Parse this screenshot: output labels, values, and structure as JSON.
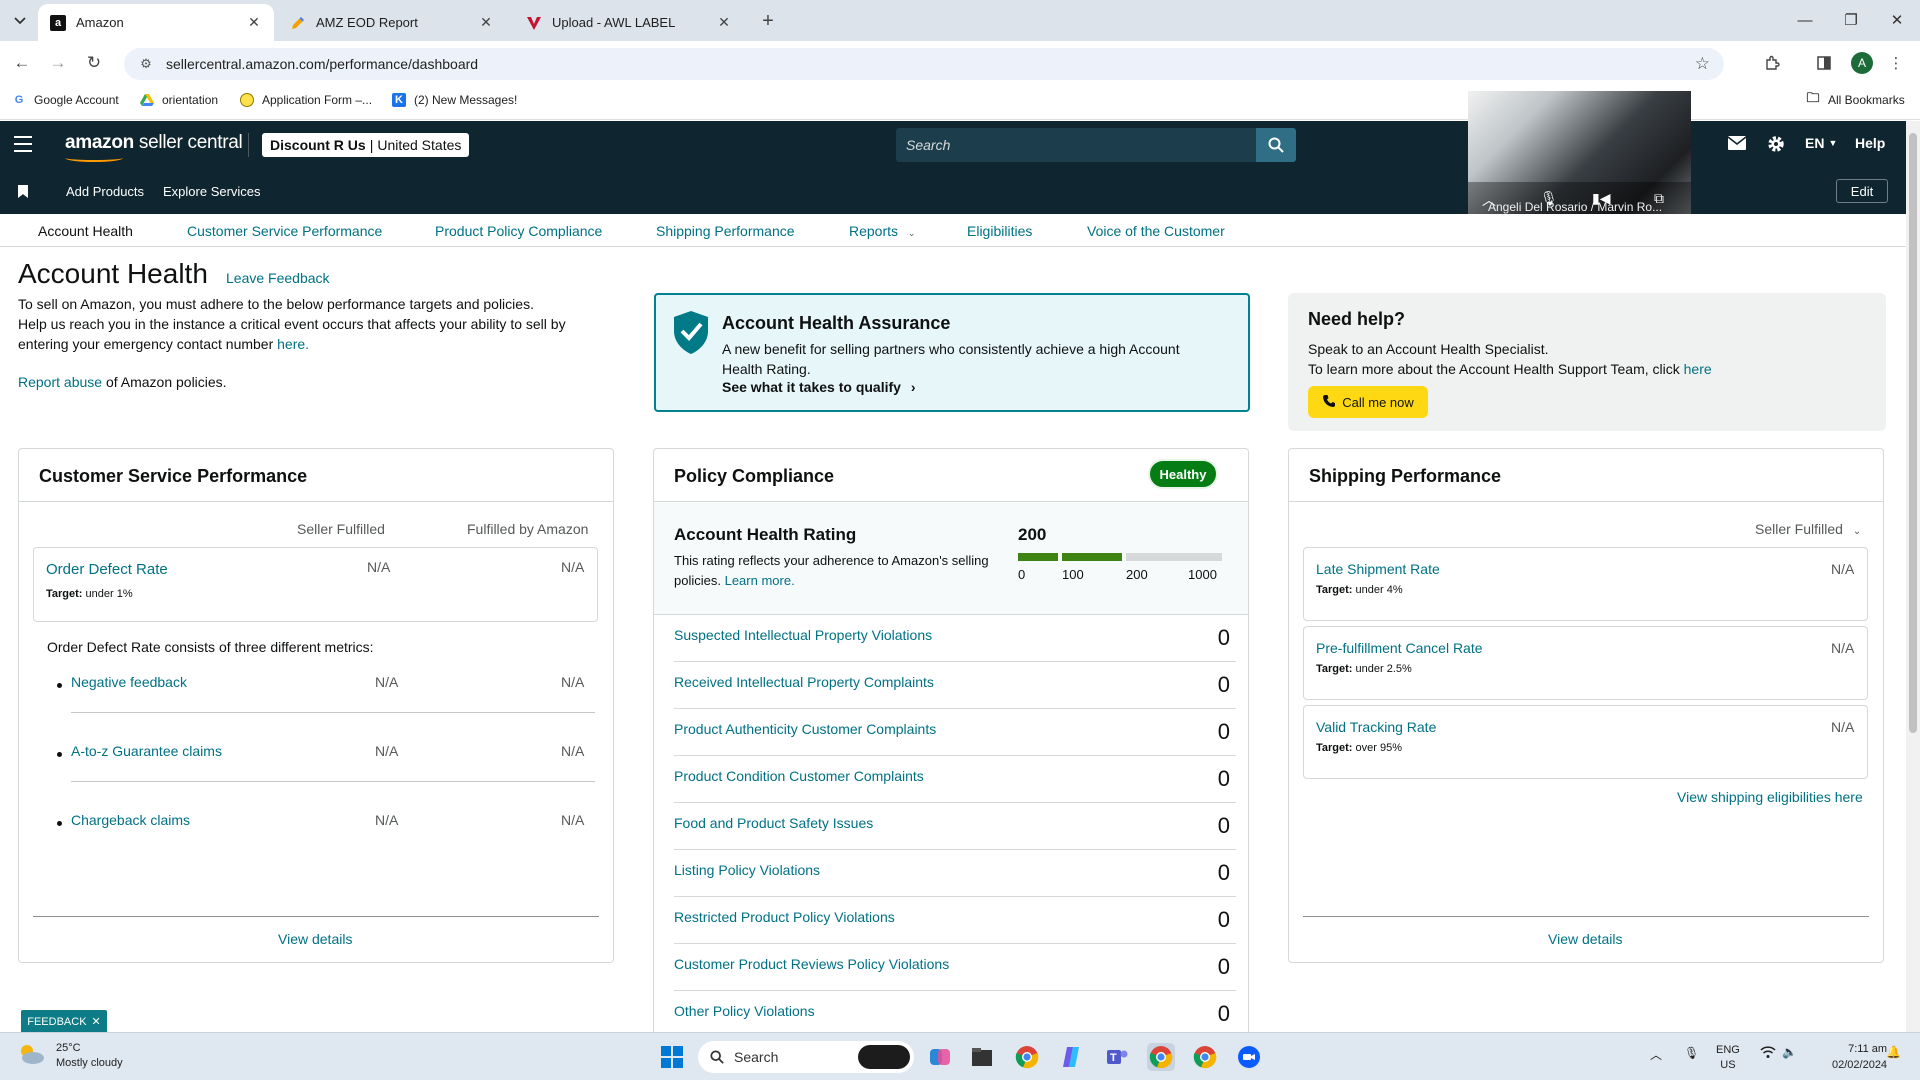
{
  "browser": {
    "tabs": [
      {
        "title": "Amazon",
        "favicon": "a"
      },
      {
        "title": "AMZ EOD Report",
        "favicon": "pen-icon"
      },
      {
        "title": "Upload - AWL LABEL",
        "favicon": "v-icon"
      }
    ],
    "url": "sellercentral.amazon.com/performance/dashboard",
    "profile_initial": "A",
    "bookmarks": [
      "Google Account",
      "orientation",
      "Application Form –...",
      "(2) New Messages!"
    ],
    "all_bookmarks": "All Bookmarks"
  },
  "header": {
    "logo_bold": "amazon",
    "logo_rest": " seller central",
    "store_name": "Discount R Us",
    "store_region": "United States",
    "search_placeholder": "Search",
    "language": "EN",
    "help": "Help",
    "sub_links": [
      "Add Products",
      "Explore Services"
    ],
    "edit": "Edit"
  },
  "video_call": {
    "participants": "Angeli Del Rosario / Marvin Ro..."
  },
  "page_nav": [
    "Account Health",
    "Customer Service Performance",
    "Product Policy Compliance",
    "Shipping Performance",
    "Reports",
    "Eligibilities",
    "Voice of the Customer"
  ],
  "intro": {
    "title": "Account Health",
    "leave_feedback": "Leave Feedback",
    "line1": "To sell on Amazon, you must adhere to the below performance targets and policies.",
    "line2": "Help us reach you in the instance a critical event occurs that affects your ability to sell by entering your emergency contact number",
    "here": "here.",
    "report_abuse": "Report abuse",
    "report_rest": " of Amazon policies."
  },
  "assurance": {
    "title": "Account Health Assurance",
    "desc": "A new benefit for selling partners who consistently achieve a high Account Health Rating.",
    "qualify": "See what it takes to qualify"
  },
  "need_help": {
    "title": "Need help?",
    "line1": "Speak to an Account Health Specialist.",
    "line2": "To learn more about the Account Health Support Team, click",
    "here": "here",
    "call": "Call me now"
  },
  "csp": {
    "title": "Customer Service Performance",
    "col1": "Seller Fulfilled",
    "col2": "Fulfilled by Amazon",
    "odr_label": "Order Defect Rate",
    "odr_target_label": "Target:",
    "odr_target": " under 1%",
    "odr_sf": "N/A",
    "odr_fba": "N/A",
    "consists": "Order Defect Rate consists of three different metrics:",
    "metrics": [
      {
        "name": "Negative feedback",
        "sf": "N/A",
        "fba": "N/A"
      },
      {
        "name": "A-to-z Guarantee claims",
        "sf": "N/A",
        "fba": "N/A"
      },
      {
        "name": "Chargeback claims",
        "sf": "N/A",
        "fba": "N/A"
      }
    ],
    "view_details": "View details"
  },
  "policy": {
    "title": "Policy Compliance",
    "status": "Healthy",
    "ahr_title": "Account Health Rating",
    "ahr_desc": "This rating reflects your adherence to Amazon's selling policies.",
    "learn_more": "Learn more.",
    "score": "200",
    "scale_labels": [
      "0",
      "100",
      "200",
      "1000"
    ],
    "rows": [
      {
        "label": "Suspected Intellectual Property Violations",
        "value": "0"
      },
      {
        "label": "Received Intellectual Property Complaints",
        "value": "0"
      },
      {
        "label": "Product Authenticity Customer Complaints",
        "value": "0"
      },
      {
        "label": "Product Condition Customer Complaints",
        "value": "0"
      },
      {
        "label": "Food and Product Safety Issues",
        "value": "0"
      },
      {
        "label": "Listing Policy Violations",
        "value": "0"
      },
      {
        "label": "Restricted Product Policy Violations",
        "value": "0"
      },
      {
        "label": "Customer Product Reviews Policy Violations",
        "value": "0"
      },
      {
        "label": "Other Policy Violations",
        "value": "0"
      }
    ]
  },
  "shipping": {
    "title": "Shipping Performance",
    "filter": "Seller Fulfilled",
    "metrics": [
      {
        "name": "Late Shipment Rate",
        "target": " under 4%",
        "value": "N/A"
      },
      {
        "name": "Pre-fulfillment Cancel Rate",
        "target": " under 2.5%",
        "value": "N/A"
      },
      {
        "name": "Valid Tracking Rate",
        "target": " over 95%",
        "value": "N/A"
      }
    ],
    "target_label": "Target:",
    "eligibilities": "View shipping eligibilities here",
    "view_details": "View details"
  },
  "feedback_tag": "FEEDBACK",
  "taskbar": {
    "temp": "25°C",
    "weather": "Mostly cloudy",
    "search": "Search",
    "lang1": "ENG",
    "lang2": "US",
    "time": "7:11 am",
    "date": "02/02/2024"
  },
  "colors": {
    "header_bg": "#0f252f",
    "link": "#007185",
    "healthy": "#067d14",
    "call_button": "#ffd814",
    "assurance_border": "#00838f"
  }
}
